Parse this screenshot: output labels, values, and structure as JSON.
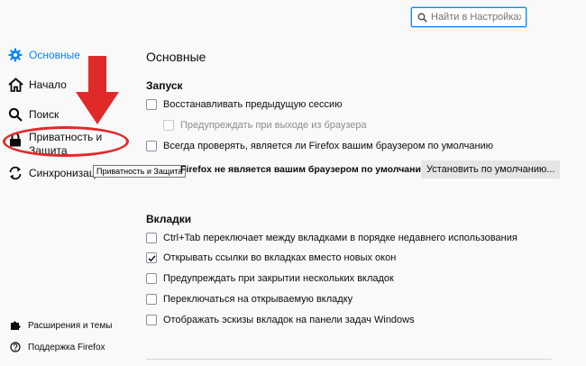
{
  "search": {
    "placeholder": "Найти в Настройках"
  },
  "sidebar": {
    "items": [
      {
        "label": "Основные",
        "icon": "gear-icon",
        "active": true
      },
      {
        "label": "Начало",
        "icon": "home-icon"
      },
      {
        "label": "Поиск",
        "icon": "search-icon"
      },
      {
        "label": "Приватность и Защита",
        "icon": "lock-icon"
      },
      {
        "label": "Синхронизация",
        "icon": "sync-icon"
      }
    ],
    "footer": [
      {
        "label": "Расширения и темы",
        "icon": "puzzle-icon"
      },
      {
        "label": "Поддержка Firefox",
        "icon": "help-icon"
      }
    ]
  },
  "tooltip": "Приватность и Защита",
  "main": {
    "title": "Основные",
    "startup": {
      "heading": "Запуск",
      "restore_session": {
        "label": "Восстанавливать предыдущую сессию",
        "checked": false
      },
      "warn_on_quit": {
        "label": "Предупреждать при выходе из браузера",
        "checked": false,
        "disabled": true
      },
      "check_default": {
        "label": "Всегда проверять, является ли Firefox вашим браузером по умолчанию",
        "checked": false
      },
      "default_status": "Firefox не является вашим браузером по умолчанию",
      "set_default_button": "Установить по умолчанию..."
    },
    "tabs": {
      "heading": "Вкладки",
      "options": [
        {
          "label": "Ctrl+Tab переключает между вкладками в порядке недавнего использования",
          "checked": false
        },
        {
          "label": "Открывать ссылки во вкладках вместо новых окон",
          "checked": true
        },
        {
          "label": "Предупреждать при закрытии нескольких вкладок",
          "checked": false
        },
        {
          "label": "Переключаться на открываемую вкладку",
          "checked": false
        },
        {
          "label": "Отображать эскизы вкладок на панели задач Windows",
          "checked": false
        }
      ]
    }
  },
  "colors": {
    "accent": "#0a84ff",
    "annotation_red": "#e02a2a"
  }
}
